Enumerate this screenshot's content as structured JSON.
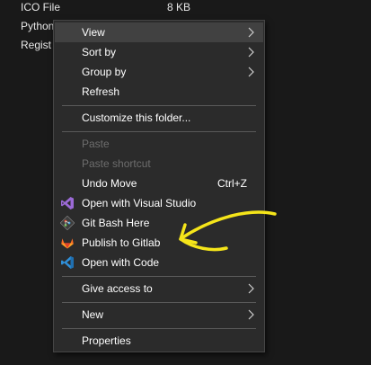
{
  "background_list": {
    "rows": [
      {
        "name": "ICO File",
        "size": "8 KB"
      },
      {
        "name": "Python",
        "size": ""
      },
      {
        "name": "Regist",
        "size": ""
      }
    ]
  },
  "context_menu": {
    "view": "View",
    "sort_by": "Sort by",
    "group_by": "Group by",
    "refresh": "Refresh",
    "customize": "Customize this folder...",
    "paste": "Paste",
    "paste_shortcut": "Paste shortcut",
    "undo_move": "Undo Move",
    "undo_move_shortcut": "Ctrl+Z",
    "open_visual_studio": "Open with Visual Studio",
    "git_bash": "Git Bash Here",
    "publish_gitlab": "Publish to Gitlab",
    "open_code": "Open with Code",
    "give_access": "Give access to",
    "new": "New",
    "properties": "Properties"
  },
  "icons": {
    "submenu": "chevron-right-icon",
    "visual_studio": "visual-studio-icon",
    "git_bash": "git-bash-icon",
    "gitlab": "gitlab-icon",
    "vscode": "vscode-icon"
  },
  "colors": {
    "menu_bg": "#2b2b2b",
    "hover_bg": "#414141",
    "disabled_text": "#6d6d6d",
    "annotation": "#f5e51a"
  }
}
